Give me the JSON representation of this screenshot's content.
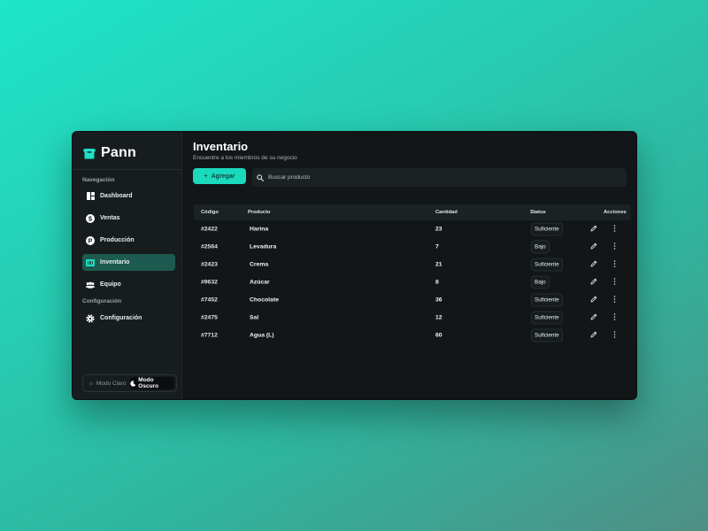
{
  "app": {
    "name": "Pann"
  },
  "sidebar": {
    "nav_section_label": "Navegación",
    "items": [
      {
        "label": "Dashboard",
        "icon": "grid-icon"
      },
      {
        "label": "Ventas",
        "icon": "dollar-icon"
      },
      {
        "label": "Producción",
        "icon": "production-icon"
      },
      {
        "label": "Inventario",
        "icon": "inventory-icon",
        "active": true
      },
      {
        "label": "Equipo",
        "icon": "team-icon"
      }
    ],
    "config_section_label": "Configuración",
    "config_items": [
      {
        "label": "Configuración",
        "icon": "gear-icon"
      }
    ],
    "theme": {
      "light_label": "Modo Claro",
      "dark_label": "Modo Oscuro",
      "selected": "dark"
    }
  },
  "page": {
    "title": "Inventario",
    "subtitle": "Encuentre a los miembros de su negocio",
    "add_button_label": "Agregar",
    "search_placeholder": "Buscar producto"
  },
  "table": {
    "columns": [
      "Código",
      "Producto",
      "Cantidad",
      "Status",
      "Acciones"
    ],
    "rows": [
      {
        "code": "#2422",
        "product": "Harina",
        "quantity": "23",
        "status": "Suficiente"
      },
      {
        "code": "#2564",
        "product": "Levadura",
        "quantity": "7",
        "status": "Bajo"
      },
      {
        "code": "#2423",
        "product": "Crema",
        "quantity": "21",
        "status": "Suficiente"
      },
      {
        "code": "#9632",
        "product": "Azúcar",
        "quantity": "8",
        "status": "Bajo"
      },
      {
        "code": "#7452",
        "product": "Chocolate",
        "quantity": "36",
        "status": "Suficiente"
      },
      {
        "code": "#2475",
        "product": "Sal",
        "quantity": "12",
        "status": "Suficiente"
      },
      {
        "code": "#7712",
        "product": "Agua (L)",
        "quantity": "60",
        "status": "Suficiente"
      }
    ]
  },
  "colors": {
    "accent": "#1ad9bd",
    "active_nav": "#1d5a50",
    "panel": "#121618"
  }
}
